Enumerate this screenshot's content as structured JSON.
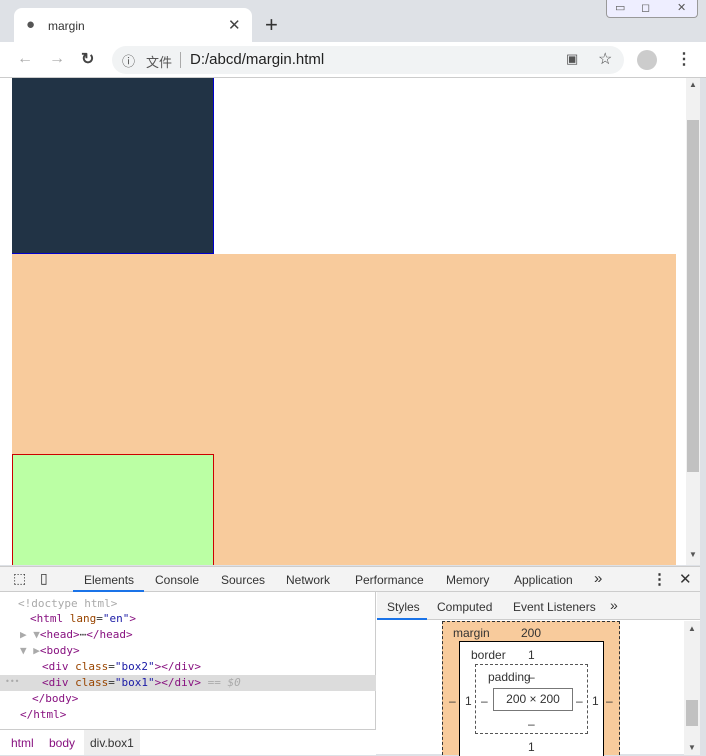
{
  "browser": {
    "tab_title": "margin",
    "url_prefix": "文件",
    "url": "D:/abcd/margin.html"
  },
  "colors": {
    "box2": "#213345",
    "margin_area": "#f8cb9c",
    "box1": "#bbffa4",
    "box1_border": "#cc0000"
  },
  "devtools": {
    "tabs": [
      "Elements",
      "Console",
      "Sources",
      "Network",
      "Performance",
      "Memory",
      "Application"
    ],
    "more": "»",
    "dom": {
      "doctype": "<!doctype html>",
      "html_open": "<html",
      "lang_attr": "lang",
      "lang_val": "\"en\"",
      "head": "head",
      "ellipsis": "⋯",
      "body": "body",
      "div": "div",
      "class_attr": "class",
      "box2": "\"box2\"",
      "box1": "\"box1\"",
      "selected_marker": "== $0",
      "row_dots": "•••"
    },
    "breadcrumb": [
      "html",
      "body",
      "div.box1"
    ],
    "styles_tabs": [
      "Styles",
      "Computed",
      "Event Listeners"
    ],
    "box_model": {
      "margin_label": "margin",
      "margin_top": "200",
      "margin_left": "–",
      "margin_right": "–",
      "border_label": "border",
      "border_top": "1",
      "border_left": "1",
      "border_right": "1",
      "border_bottom": "1",
      "padding_label": "padding",
      "padding_top": "–",
      "padding_left": "–",
      "padding_right": "–",
      "padding_bottom": "–",
      "content": "200 × 200"
    }
  }
}
